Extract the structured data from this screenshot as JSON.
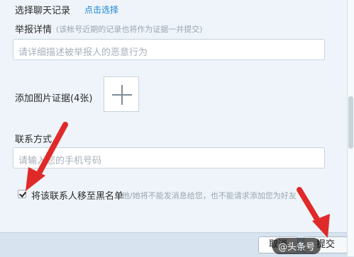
{
  "chat_record": {
    "label": "选择聊天记录",
    "link": "点击选择"
  },
  "report_detail": {
    "label": "举报详情",
    "hint": "(该帐号近期的记录也将作为证据一并提交)",
    "placeholder": "请详细描述被举报人的恶意行为"
  },
  "image_evidence": {
    "label": "添加图片证据(4张)"
  },
  "contact": {
    "label": "联系方式",
    "placeholder": "请输入您的手机号码"
  },
  "blacklist": {
    "label": "将该联系人移至黑名单",
    "hint": "他/她将不能发消息给您，也不能请求添加您为好友",
    "checked": true
  },
  "footer": {
    "cancel_label": "取消",
    "submit_label": "提交"
  },
  "watermark": {
    "text": "@头条号"
  },
  "colors": {
    "accent": "#1f86d6",
    "arrow": "#e02a2a",
    "footer": "#d7e4ef"
  }
}
